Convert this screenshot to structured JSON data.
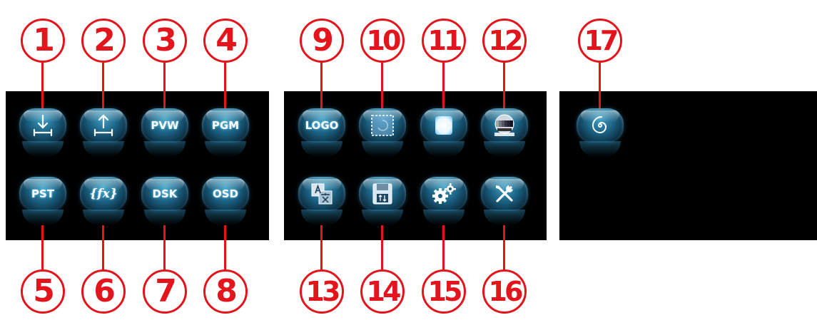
{
  "colors": {
    "callout": "#e3141b",
    "panel": "#000000",
    "button": "#1a5f80"
  },
  "callouts": [
    {
      "number": "1"
    },
    {
      "number": "2"
    },
    {
      "number": "3"
    },
    {
      "number": "4"
    },
    {
      "number": "5"
    },
    {
      "number": "6"
    },
    {
      "number": "7"
    },
    {
      "number": "8"
    },
    {
      "number": "9"
    },
    {
      "number": "10"
    },
    {
      "number": "11"
    },
    {
      "number": "12"
    },
    {
      "number": "13"
    },
    {
      "number": "14"
    },
    {
      "number": "15"
    },
    {
      "number": "16"
    },
    {
      "number": "17"
    }
  ],
  "buttons": {
    "pvw": "PVW",
    "pgm": "PGM",
    "pst": "PST",
    "fx": "{fx}",
    "dsk": "DSK",
    "osd": "OSD",
    "logo": "LOGO"
  },
  "icons": [
    "import-icon",
    "export-icon",
    "pvw-icon",
    "pgm-icon",
    "pst-icon",
    "fx-icon",
    "dsk-icon",
    "osd-icon",
    "logo-icon",
    "frame-icon",
    "glow-square-icon",
    "test-pattern-icon",
    "language-icon",
    "save-icon",
    "settings-icon",
    "tools-icon",
    "spiral-icon"
  ]
}
